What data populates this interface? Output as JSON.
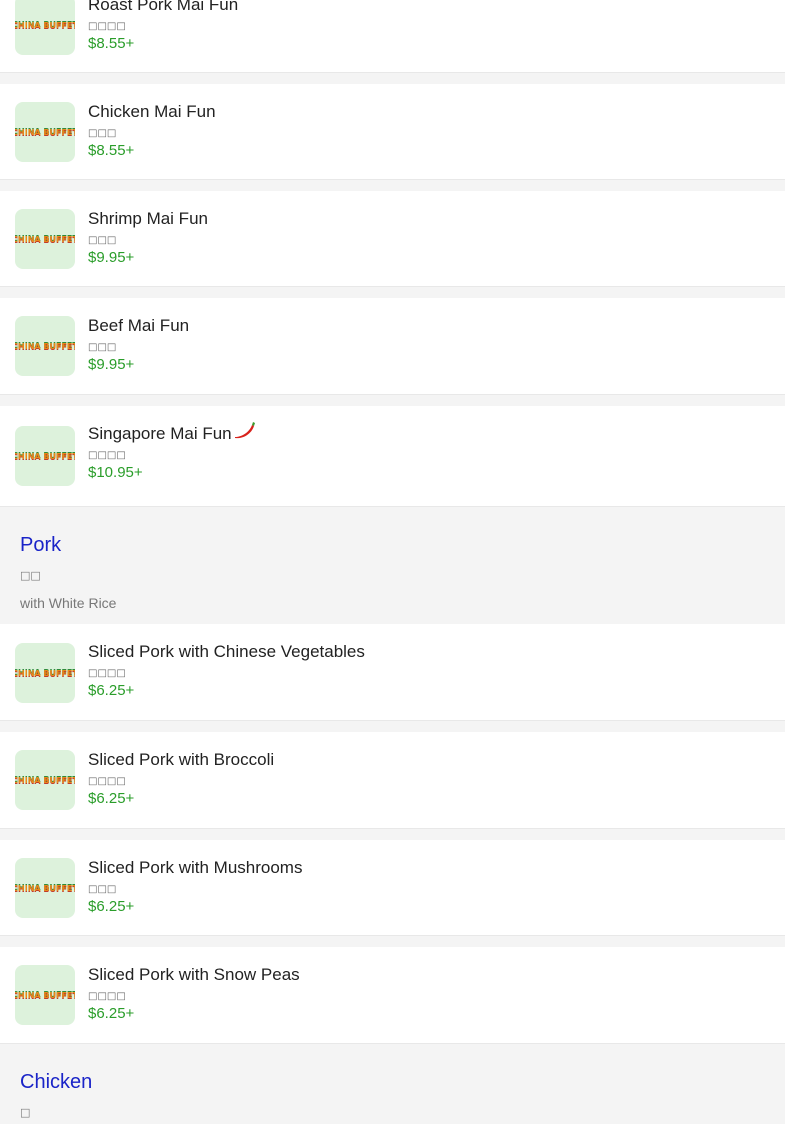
{
  "items_top": [
    {
      "name": "Roast Pork Mai Fun",
      "cn": "□□□□",
      "price": "$8.55+",
      "spicy": false
    },
    {
      "name": "Chicken Mai Fun",
      "cn": "□□□",
      "price": "$8.55+",
      "spicy": false
    },
    {
      "name": "Shrimp Mai Fun",
      "cn": "□□□",
      "price": "$9.95+",
      "spicy": false
    },
    {
      "name": "Beef Mai Fun",
      "cn": "□□□",
      "price": "$9.95+",
      "spicy": false
    },
    {
      "name": "Singapore Mai Fun",
      "cn": "□□□□",
      "price": "$10.95+",
      "spicy": true
    }
  ],
  "sections": [
    {
      "title": "Pork",
      "cn": "□□",
      "note": "with White Rice",
      "items": [
        {
          "name": "Sliced Pork with Chinese Vegetables",
          "cn": "□□□□",
          "price": "$6.25+"
        },
        {
          "name": "Sliced Pork with Broccoli",
          "cn": "□□□□",
          "price": "$6.25+"
        },
        {
          "name": "Sliced Pork with Mushrooms",
          "cn": "□□□",
          "price": "$6.25+"
        },
        {
          "name": "Sliced Pork with Snow Peas",
          "cn": "□□□□",
          "price": "$6.25+"
        }
      ]
    },
    {
      "title": "Chicken",
      "cn": "□",
      "note": "",
      "items": []
    }
  ],
  "logo_text": "CHINA BUFFET",
  "colors": {
    "section_title": "#1a24c8",
    "price": "#2a9d2a",
    "thumb_bg": "#ddf2dc",
    "page_bg": "#f4f4f4"
  }
}
